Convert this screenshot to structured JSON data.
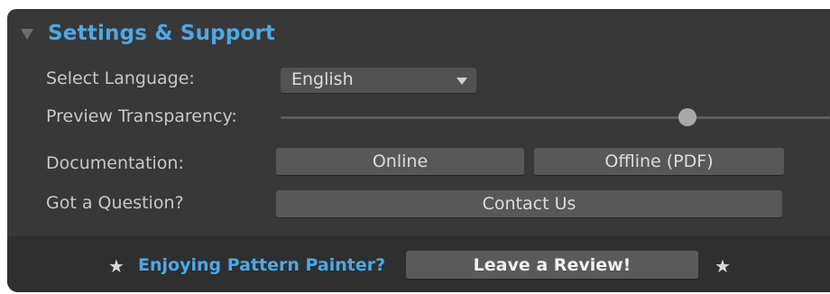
{
  "section": {
    "title": "Settings & Support"
  },
  "language": {
    "label": "Select Language:",
    "selected": "English"
  },
  "transparency": {
    "label": "Preview Transparency:",
    "value_fraction": 0.74
  },
  "documentation": {
    "label": "Documentation:",
    "online_label": "Online",
    "offline_label": "Offline (PDF)"
  },
  "question": {
    "label": "Got a Question?",
    "contact_label": "Contact Us"
  },
  "footer": {
    "promo_text": "Enjoying Pattern Painter?",
    "review_label": "Leave a Review!",
    "star_glyph": "★"
  },
  "colors": {
    "panel_bg": "#383838",
    "accent": "#4ea7e6",
    "button_bg": "#585858"
  },
  "icons": {
    "collapse": "caret-down-icon",
    "dropdown": "chevron-down-icon",
    "star": "star-icon"
  }
}
